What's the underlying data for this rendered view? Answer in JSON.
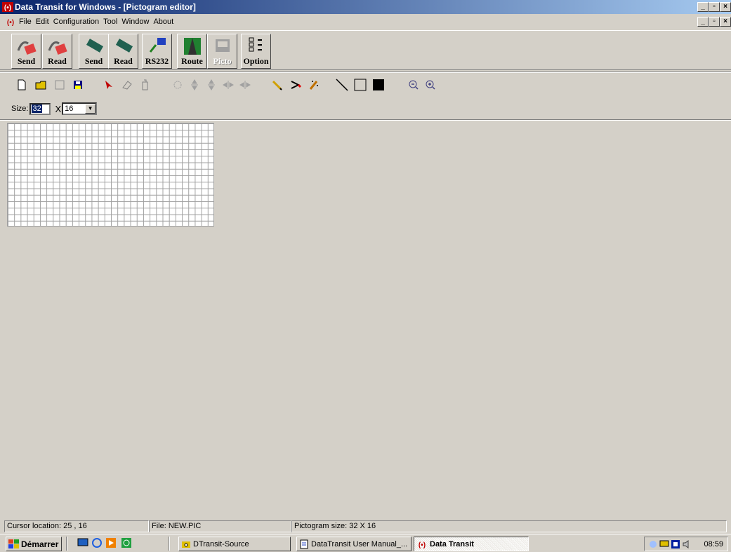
{
  "window": {
    "title": "Data Transit for Windows - [Pictogram editor]"
  },
  "menu": {
    "items": [
      "File",
      "Edit",
      "Configuration",
      "Tool",
      "Window",
      "About"
    ]
  },
  "big_toolbar": {
    "send1": "Send",
    "read1": "Read",
    "send2": "Send",
    "read2": "Read",
    "rs232": "RS232",
    "route": "Route",
    "picto": "Picto",
    "option": "Option"
  },
  "size_bar": {
    "label": "Size:",
    "width_value": "32",
    "times": "X",
    "height_value": "16"
  },
  "status": {
    "cursor": "Cursor location:  25 , 16",
    "file": "File:  NEW.PIC",
    "size": "Pictogram size:  32 X 16"
  },
  "taskbar": {
    "start": "Démarrer",
    "tasks": [
      "DTransit-Source",
      "DataTransit User Manual_...",
      "Data Transit"
    ],
    "clock": "08:59"
  },
  "colors": {
    "title_start": "#0a246a",
    "title_end": "#a6caf0",
    "face": "#d4d0c8"
  }
}
